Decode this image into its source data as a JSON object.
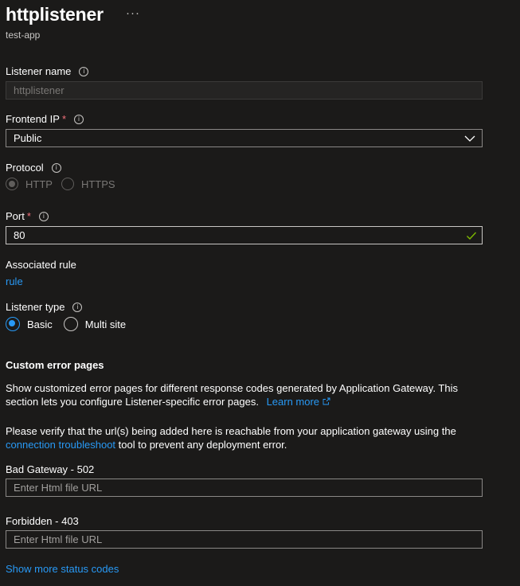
{
  "header": {
    "title": "httplistener",
    "more": "···",
    "subtitle": "test-app"
  },
  "listener_name": {
    "label": "Listener name",
    "value": "httplistener"
  },
  "frontend_ip": {
    "label": "Frontend IP",
    "required": "*",
    "value": "Public"
  },
  "protocol": {
    "label": "Protocol",
    "options": [
      "HTTP",
      "HTTPS"
    ],
    "selected": "HTTP"
  },
  "port": {
    "label": "Port",
    "required": "*",
    "value": "80"
  },
  "associated_rule": {
    "label": "Associated rule",
    "link": "rule"
  },
  "listener_type": {
    "label": "Listener type",
    "options": [
      "Basic",
      "Multi site"
    ],
    "selected": "Basic"
  },
  "custom_error": {
    "title": "Custom error pages",
    "desc": "Show customized error pages for different response codes generated by Application Gateway. This section lets you configure Listener-specific error pages.",
    "learn_more": "Learn more",
    "verify_pre": "Please verify that the url(s) being added here is reachable from your application gateway using the",
    "verify_link": "connection troubleshoot",
    "verify_post": "tool to prevent any deployment error.",
    "bad_gateway": {
      "label": "Bad Gateway - 502",
      "placeholder": "Enter Html file URL"
    },
    "forbidden": {
      "label": "Forbidden - 403",
      "placeholder": "Enter Html file URL"
    },
    "show_more": "Show more status codes"
  },
  "colors": {
    "background": "#1b1a19",
    "accent": "#2899f5",
    "required": "#f1707b",
    "success": "#7fba00"
  }
}
